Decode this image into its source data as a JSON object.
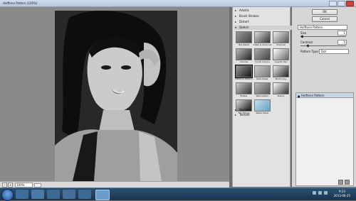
{
  "window": {
    "title": "Halftone Pattern (100%)"
  },
  "status": {
    "zoom": "100%"
  },
  "filters": {
    "folders_top": [
      "Artistic",
      "Brush Strokes",
      "Distort"
    ],
    "sketch_folder": "Sketch",
    "sketch_items": [
      {
        "label": "Bas Relief"
      },
      {
        "label": "Chalk & Charcoal"
      },
      {
        "label": "Charcoal"
      },
      {
        "label": "Chrome"
      },
      {
        "label": "Conté Crayon"
      },
      {
        "label": "Graphic Pen"
      },
      {
        "label": "Halftone Pattern"
      },
      {
        "label": "Note Paper"
      },
      {
        "label": "Photocopy"
      },
      {
        "label": "Plaster"
      },
      {
        "label": "Reticulation"
      },
      {
        "label": "Stamp"
      },
      {
        "label": "Torn Edges"
      },
      {
        "label": "Water Paper"
      }
    ],
    "selected_item": "Halftone Pattern",
    "folders_bottom": [
      "Stylize",
      "Texture"
    ]
  },
  "controls": {
    "ok_label": "OK",
    "cancel_label": "Cancel",
    "filter_select": "Halftone Pattern",
    "size_label": "Size",
    "size_value": "1",
    "contrast_label": "Contrast",
    "contrast_value": "5",
    "pattern_type_label": "Pattern Type:",
    "pattern_type_value": "Dot"
  },
  "effects_layer": {
    "name": "Halftone Pattern"
  },
  "taskbar": {
    "time": "9:23",
    "date": "2013-06-25"
  }
}
